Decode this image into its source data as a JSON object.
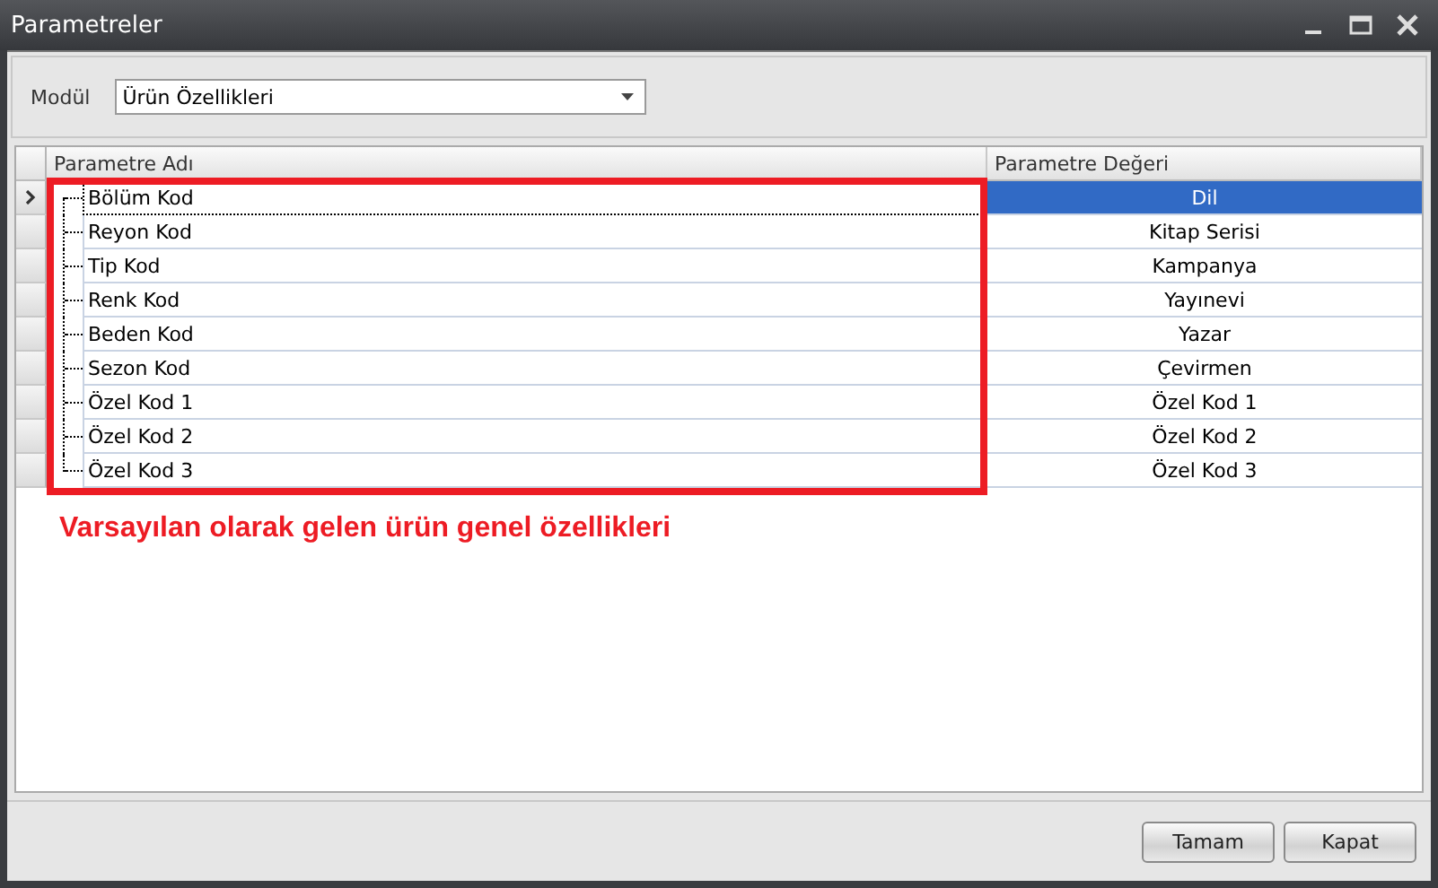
{
  "window": {
    "title": "Parametreler"
  },
  "filter": {
    "label": "Modül",
    "value": "Ürün Özellikleri"
  },
  "table": {
    "columns": [
      "Parametre Adı",
      "Parametre Değeri"
    ],
    "rows": [
      {
        "name": "Bölüm Kod",
        "value": "Dil",
        "selected": true
      },
      {
        "name": "Reyon Kod",
        "value": "Kitap Serisi",
        "selected": false
      },
      {
        "name": "Tip Kod",
        "value": "Kampanya",
        "selected": false
      },
      {
        "name": "Renk Kod",
        "value": "Yayınevi",
        "selected": false
      },
      {
        "name": "Beden Kod",
        "value": "Yazar",
        "selected": false
      },
      {
        "name": "Sezon Kod",
        "value": "Çevirmen",
        "selected": false
      },
      {
        "name": "Özel Kod 1",
        "value": "Özel Kod 1",
        "selected": false
      },
      {
        "name": "Özel Kod 2",
        "value": "Özel Kod 2",
        "selected": false
      },
      {
        "name": "Özel Kod 3",
        "value": "Özel Kod 3",
        "selected": false
      }
    ]
  },
  "annotation": "Varsayılan olarak gelen ürün genel özellikleri",
  "buttons": [
    "Tamam",
    "Kapat"
  ]
}
